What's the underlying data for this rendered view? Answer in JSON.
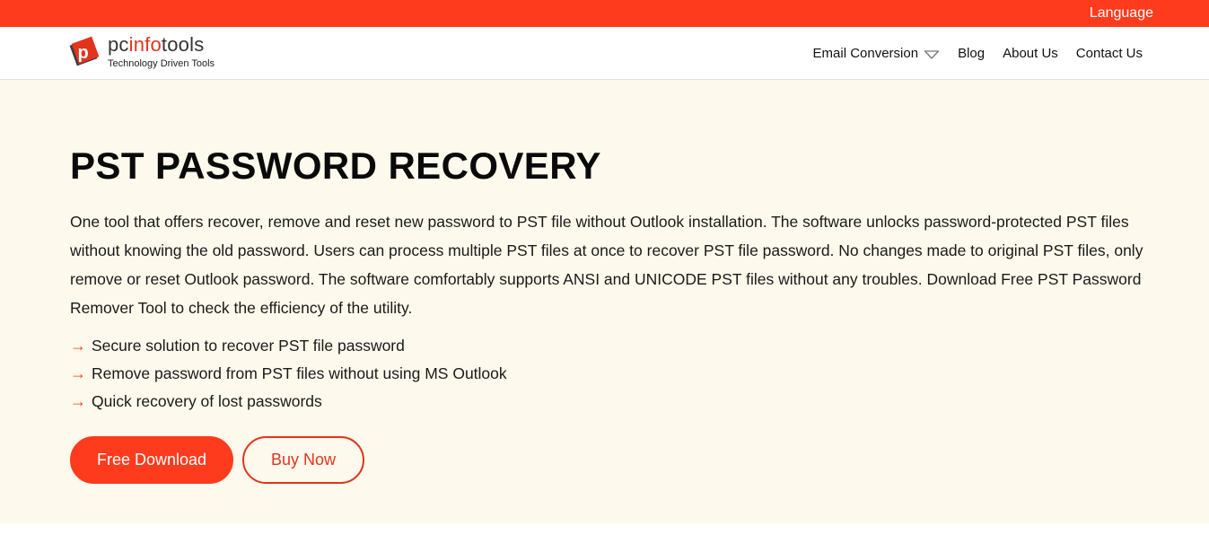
{
  "topbar": {
    "language_label": "Language",
    "accent": "#ff3b1d"
  },
  "logo": {
    "name_prefix": "pc",
    "name_highlight": "info",
    "name_suffix": "tools",
    "tagline": "Technology Driven Tools",
    "mark_letter": "p"
  },
  "nav": {
    "items": [
      {
        "label": "Email Conversion",
        "icon": "chevron-down-icon"
      },
      {
        "label": "Blog"
      },
      {
        "label": "About Us"
      },
      {
        "label": "Contact Us"
      }
    ]
  },
  "hero": {
    "title": "PST PASSWORD RECOVERY",
    "description": "One tool that offers recover, remove and reset new password to PST file without Outlook installation. The software unlocks password-protected PST files without knowing the old password. Users can process multiple PST files at once to recover PST file password. No changes made to original PST files, only remove or reset Outlook password. The software comfortably supports ANSI and UNICODE PST files without any troubles. Download Free PST Password Remover Tool to check the efficiency of the utility.",
    "bullet_symbol": "→",
    "features": [
      "Secure solution to recover PST file password",
      "Remove password from PST files without using MS Outlook",
      "Quick recovery of lost passwords"
    ],
    "buttons": {
      "download_label": "Free Download",
      "buy_label": "Buy Now"
    },
    "background": "#fdf9ec"
  }
}
